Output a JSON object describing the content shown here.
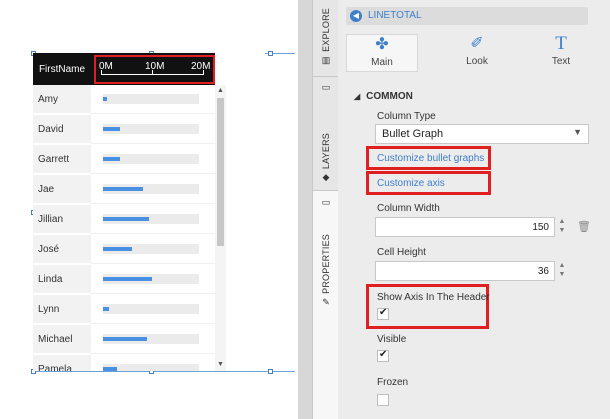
{
  "grid": {
    "header_name": "FirstName",
    "axis_ticks": [
      "0M",
      "10M",
      "20M"
    ],
    "rows": [
      {
        "name": "Amy",
        "value": 0.04
      },
      {
        "name": "David",
        "value": 0.18
      },
      {
        "name": "Garrett",
        "value": 0.18
      },
      {
        "name": "Jae",
        "value": 0.42
      },
      {
        "name": "Jillian",
        "value": 0.48
      },
      {
        "name": "José",
        "value": 0.3
      },
      {
        "name": "Linda",
        "value": 0.51
      },
      {
        "name": "Lynn",
        "value": 0.06
      },
      {
        "name": "Michael",
        "value": 0.46
      },
      {
        "name": "Pamela",
        "value": 0.15
      }
    ],
    "bar_color": "#4a90e2"
  },
  "tabs": {
    "explore": "EXPLORE",
    "layers": "LAYERS",
    "properties": "PROPERTIES"
  },
  "panel": {
    "breadcrumb": "LINETOTAL",
    "prop_tabs": {
      "main": "Main",
      "look": "Look",
      "text": "Text"
    },
    "section": "COMMON",
    "column_type_label": "Column Type",
    "column_type_value": "Bullet Graph",
    "customize_bullet": "Customize bullet graphs",
    "customize_axis": "Customize axis",
    "column_width_label": "Column Width",
    "column_width_value": "150",
    "cell_height_label": "Cell Height",
    "cell_height_value": "36",
    "show_axis_label": "Show Axis In The Header",
    "show_axis_checked": true,
    "visible_label": "Visible",
    "visible_checked": true,
    "frozen_label": "Frozen",
    "frozen_checked": false
  },
  "colors": {
    "accent": "#3f7fc9",
    "highlight": "#e02020"
  }
}
